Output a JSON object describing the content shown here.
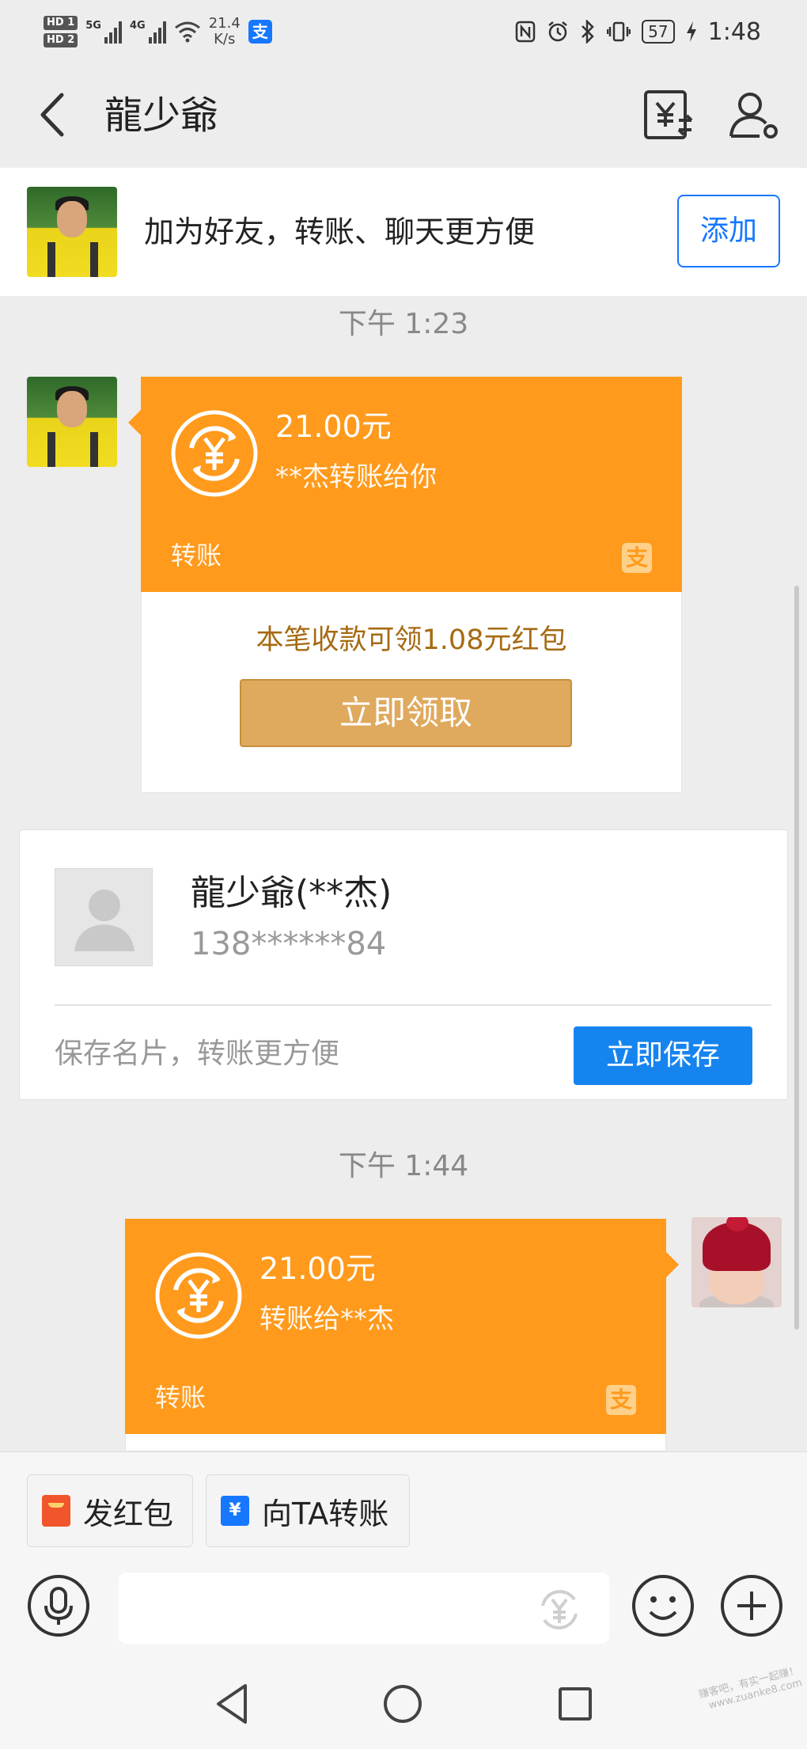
{
  "status_bar": {
    "hd1": "HD 1",
    "hd2": "HD 2",
    "net1": "5G",
    "net2": "4G",
    "speed_value": "21.4",
    "speed_unit": "K/s",
    "battery": "57",
    "time": "1:48"
  },
  "header": {
    "title": "龍少爺",
    "back_icon": "chevron-left-icon",
    "bill_icon": "transfer-bill-icon",
    "profile_icon": "person-settings-icon"
  },
  "friend_banner": {
    "text": "加为好友，转账、聊天更方便",
    "button": "添加"
  },
  "messages": [
    {
      "time": "下午 1:23",
      "direction": "incoming",
      "amount": "21.00元",
      "subtitle": "**杰转账给你",
      "label": "转账",
      "promo": "本笔收款可领1.08元红包",
      "claim_button": "立即领取"
    },
    {
      "time": "下午 1:44",
      "direction": "outgoing",
      "amount": "21.00元",
      "subtitle": "转账给**杰",
      "label": "转账"
    }
  ],
  "contact_card": {
    "name": "龍少爺(**杰)",
    "phone": "138******84",
    "save_tip": "保存名片，转账更方便",
    "save_button": "立即保存"
  },
  "quick_actions": [
    {
      "label": "发红包",
      "icon": "red-packet-icon"
    },
    {
      "label": "向TA转账",
      "icon": "transfer-icon"
    }
  ],
  "input_bar": {
    "placeholder": ""
  },
  "colors": {
    "transfer_orange": "#ff9a1c",
    "accent_blue": "#1677ff",
    "claim_gold": "#dfa95e",
    "promo_brown": "#a66a12"
  },
  "watermark": {
    "line1": "赚客吧，有实一起赚！",
    "line2": "www.zuanke8.com"
  }
}
